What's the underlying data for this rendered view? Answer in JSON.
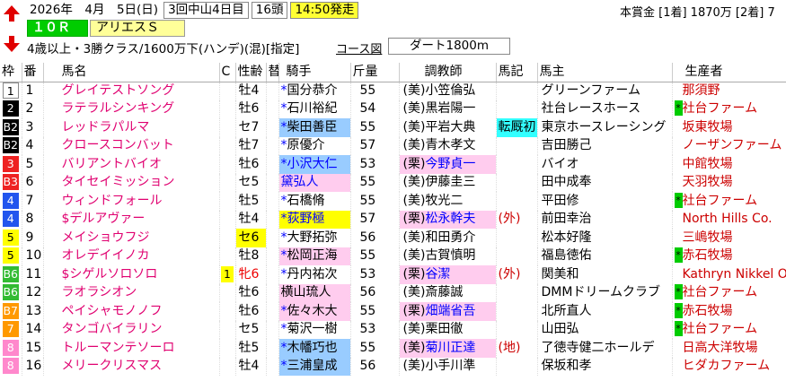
{
  "header": {
    "date": "2026年　4月　5日(日)",
    "meeting": "3回中山4日目",
    "runners": "16頭",
    "post_time": "14:50発走",
    "race_no": "１０Ｒ",
    "race_name": "アリエスＳ",
    "conditions": "4歳以上・3勝クラス/1600万下(ハンデ)(混)[指定]",
    "course_link": "コース図",
    "course": "ダート1800m",
    "prize": "本賞金 [1着] 1870万 [2着] 7"
  },
  "columns": {
    "waku": "枠",
    "num": "番",
    "name": "馬名",
    "c": "C",
    "sex": "性齢",
    "kae": "替",
    "jockey": "騎手",
    "weight": "斤量",
    "trainer": "調教師",
    "basho": "馬記",
    "owner": "馬主",
    "breeder": "生産者"
  },
  "colors": {
    "waku1": "#ffffff",
    "waku2": "#000000",
    "waku3": "#ee2222",
    "waku4": "#2255ee",
    "waku5": "#ffff00",
    "waku6": "#33bb33",
    "waku7": "#ff9900",
    "waku8": "#ff88cc"
  },
  "horses": [
    {
      "waku": "1",
      "num": "1",
      "name": "グレイテストソング",
      "sex": "牡4",
      "jmark": "*",
      "jockey": "国分恭介",
      "weight": "55",
      "tarea": "(美)",
      "trainer": "小笠倫弘",
      "owner": "グリーンファーム",
      "breeder": "那須野"
    },
    {
      "waku": "2",
      "num": "2",
      "name": "ラテラルシンキング",
      "sex": "牡6",
      "jmark": "*",
      "jockey": "石川裕紀",
      "weight": "54",
      "tarea": "(美)",
      "trainer": "黒岩陽一",
      "owner": "社台レースホース",
      "bmark": "*",
      "breeder": "社台ファーム"
    },
    {
      "waku": "B2",
      "num": "3",
      "name": "レッドラパルマ",
      "sex": "セ7",
      "jmark": "*",
      "jockey": "柴田善臣",
      "weight": "55",
      "tarea": "(美)",
      "trainer": "平岩大典",
      "basho": "転厩初",
      "owner": "東京ホースレーシング",
      "breeder": "坂東牧場"
    },
    {
      "waku": "B2",
      "num": "4",
      "name": "クロースコンバット",
      "sex": "牡7",
      "jmark": "*",
      "jockey": "原優介",
      "weight": "57",
      "tarea": "(美)",
      "trainer": "青木孝文",
      "owner": "吉田勝己",
      "breeder": "ノーザンファーム"
    },
    {
      "waku": "3",
      "num": "5",
      "name": "バリアントバイオ",
      "sex": "牡6",
      "jmark": "*",
      "jockey": "小沢大仁",
      "weight": "53",
      "tarea": "(栗)",
      "trainer": "今野貞一",
      "owner": "バイオ",
      "breeder": "中館牧場"
    },
    {
      "waku": "B3",
      "num": "6",
      "name": "タイセイミッション",
      "sex": "セ5",
      "jmark": "",
      "jockey": "黛弘人",
      "weight": "55",
      "tarea": "(美)",
      "trainer": "伊藤圭三",
      "owner": "田中成奉",
      "breeder": "天羽牧場"
    },
    {
      "waku": "4",
      "num": "7",
      "name": "ウィンドフォール",
      "sex": "牡5",
      "jmark": "*",
      "jockey": "石橋脩",
      "weight": "55",
      "tarea": "(美)",
      "trainer": "牧光二",
      "owner": "平田修",
      "bmark": "*",
      "breeder": "社台ファーム"
    },
    {
      "waku": "4",
      "num": "8",
      "name": "$デルアヴァー",
      "sex": "牡4",
      "jmark": "*",
      "jockey": "荻野極",
      "weight": "57",
      "tarea": "(栗)",
      "trainer": "松永幹夫",
      "basho": "(外)",
      "owner": "前田幸治",
      "breeder": "North Hills Co."
    },
    {
      "waku": "5",
      "num": "9",
      "name": "メイショウフジ",
      "sex": "セ6",
      "jmark": "*",
      "jockey": "大野拓弥",
      "weight": "56",
      "tarea": "(美)",
      "trainer": "和田勇介",
      "owner": "松本好隆",
      "breeder": "三嶋牧場"
    },
    {
      "waku": "5",
      "num": "10",
      "name": "オレデイイノカ",
      "sex": "牡8",
      "jmark": "*",
      "jockey": "松岡正海",
      "weight": "55",
      "tarea": "(美)",
      "trainer": "古賀慎明",
      "owner": "福島徳佑",
      "bmark": "*",
      "breeder": "赤石牧場"
    },
    {
      "waku": "B6",
      "num": "11",
      "name": "$シゲルソロソロ",
      "c": "1",
      "sex": "牝6",
      "jmark": "*",
      "jockey": "丹内祐次",
      "weight": "53",
      "tarea": "(栗)",
      "trainer": "谷潔",
      "basho": "(外)",
      "owner": "関美和",
      "breeder": "Kathryn Nikkel Old"
    },
    {
      "waku": "B6",
      "num": "12",
      "name": "ラオラシオン",
      "sex": "牡6",
      "jmark": "",
      "jockey": "横山琉人",
      "weight": "56",
      "tarea": "(美)",
      "trainer": "斎藤誠",
      "owner": "DMMドリームクラブ",
      "bmark": "*",
      "breeder": "社台ファーム"
    },
    {
      "waku": "B7",
      "num": "13",
      "name": "ペイシャモノノフ",
      "sex": "牡6",
      "jmark": "*",
      "jockey": "佐々木大",
      "weight": "55",
      "tarea": "(栗)",
      "trainer": "畑端省吾",
      "owner": "北所直人",
      "bmark": "*",
      "breeder": "赤石牧場"
    },
    {
      "waku": "7",
      "num": "14",
      "name": "タンゴバイラリン",
      "sex": "セ5",
      "jmark": "*",
      "jockey": "菊沢一樹",
      "weight": "53",
      "tarea": "(美)",
      "trainer": "栗田徹",
      "owner": "山田弘",
      "bmark": "*",
      "breeder": "社台ファーム"
    },
    {
      "waku": "8",
      "num": "15",
      "name": "トルーマンテソーロ",
      "sex": "牡5",
      "jmark": "*",
      "jockey": "木幡巧也",
      "weight": "55",
      "tarea": "(美)",
      "trainer": "菊川正達",
      "basho": "(地)",
      "owner": "了徳寺健二ホールデ",
      "breeder": "日高大洋牧場"
    },
    {
      "waku": "8",
      "num": "16",
      "name": "メリークリスマス",
      "sex": "牡4",
      "jmark": "*",
      "jockey": "三浦皇成",
      "weight": "56",
      "tarea": "(美)",
      "trainer": "小手川準",
      "owner": "保坂和孝",
      "breeder": "ヒダカファーム"
    }
  ]
}
